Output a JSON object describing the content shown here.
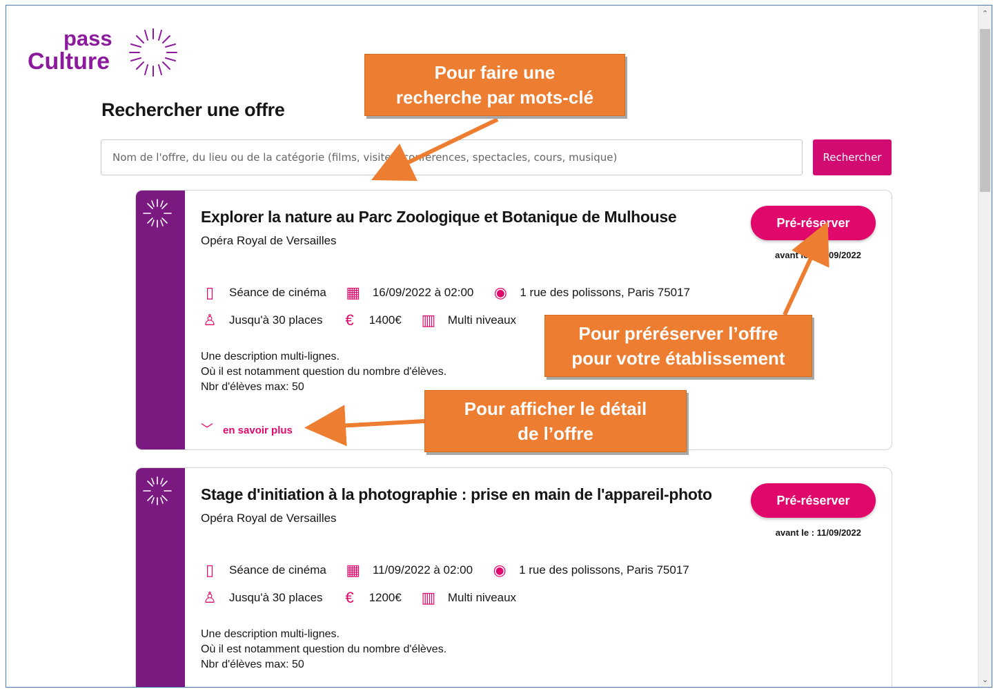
{
  "logo": {
    "line1": "pass",
    "line2": "Culture"
  },
  "page_title": "Rechercher une offre",
  "search": {
    "placeholder": "Nom de l'offre, du lieu ou de la catégorie (films, visites, conférences, spectacles, cours, musique)",
    "button_label": "Rechercher"
  },
  "offers": [
    {
      "title": "Explorer la nature au Parc Zoologique et Botanique de Mulhouse",
      "venue": "Opéra Royal de Versailles",
      "prebook_label": "Pré-réserver",
      "deadline": "avant le : 16/09/2022",
      "category": "Séance de cinéma",
      "date": "16/09/2022 à 02:00",
      "address": "1 rue des polissons, Paris 75017",
      "places": "Jusqu'à 30 places",
      "price": "1400€",
      "level": "Multi niveaux",
      "desc_lines": [
        "Une description multi-lignes.",
        "Où il est notamment question du nombre d'élèves.",
        "Nbr d'élèves max: 50"
      ],
      "more_label": "en savoir plus"
    },
    {
      "title": "Stage d'initiation à la photographie : prise en main de l'appareil-photo",
      "venue": "Opéra Royal de Versailles",
      "prebook_label": "Pré-réserver",
      "deadline": "avant le : 11/09/2022",
      "category": "Séance de cinéma",
      "date": "11/09/2022 à 02:00",
      "address": "1 rue des polissons, Paris 75017",
      "places": "Jusqu'à 30 places",
      "price": "1200€",
      "level": "Multi niveaux",
      "desc_lines": [
        "Une description multi-lignes.",
        "Où il est notamment question du nombre d'élèves.",
        "Nbr d'élèves max: 50"
      ]
    }
  ],
  "callouts": {
    "search": [
      "Pour faire une",
      "recherche par mots-clé"
    ],
    "prebook": [
      "Pour préréserver l’offre",
      "pour votre établissement"
    ],
    "detail": [
      "Pour afficher le détail",
      "de l’offre"
    ]
  },
  "colors": {
    "brand_purple": "#7a1a80",
    "accent_pink": "#e0086b",
    "callout_orange": "#ed7d31"
  },
  "icons": [
    "ticket-icon",
    "calendar-icon",
    "location-pin-icon",
    "user-icon",
    "euro-icon",
    "building-icon",
    "sun-burst-icon",
    "chevron-down-icon"
  ]
}
